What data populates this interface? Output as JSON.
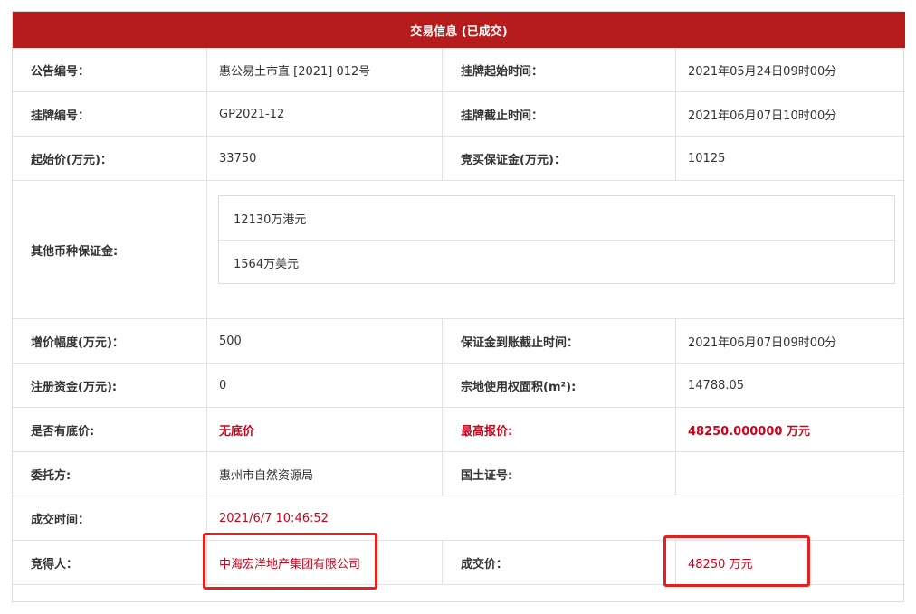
{
  "header": {
    "title": "交易信息 (已成交)"
  },
  "rows": {
    "notice_no": {
      "label": "公告编号：",
      "value": "惠公易土市直 [2021] 012号",
      "label2": "挂牌起始时间：",
      "value2": "2021年05月24日09时00分"
    },
    "listing_no": {
      "label": "挂牌编号：",
      "value": "GP2021-12",
      "label2": "挂牌截止时间：",
      "value2": "2021年06月07日10时00分"
    },
    "start_price": {
      "label": "起始价(万元)：",
      "value": "33750",
      "label2": "竞买保证金(万元)：",
      "value2": "10125"
    },
    "other_deposit": {
      "label": "其他币种保证金:",
      "items": [
        "12130万港元",
        "1564万美元"
      ]
    },
    "increment": {
      "label": "增价幅度(万元)：",
      "value": "500",
      "label2": "保证金到账截止时间：",
      "value2": "2021年06月07日09时00分"
    },
    "reg_capital": {
      "label": "注册资金(万元):",
      "value": "0",
      "label2": "宗地使用权面积(m²):",
      "value2": "14788.05"
    },
    "reserve": {
      "label": "是否有底价:",
      "value": "无底价",
      "label2": "最高报价:",
      "value2": "48250.000000 万元"
    },
    "entrust": {
      "label": "委托方:",
      "value": "惠州市自然资源局",
      "label2": "国土证号:",
      "value2": ""
    },
    "deal_time": {
      "label": "成交时间：",
      "value": "2021/6/7 10:46:52"
    },
    "winner": {
      "label": "竞得人：",
      "value": "中海宏洋地产集团有限公司",
      "label2": "成交价：",
      "value2": "48250 万元"
    }
  },
  "colors": {
    "header_bg": "#b71c1c",
    "accent_red": "#d0021b",
    "highlight_border": "#e8201d"
  }
}
